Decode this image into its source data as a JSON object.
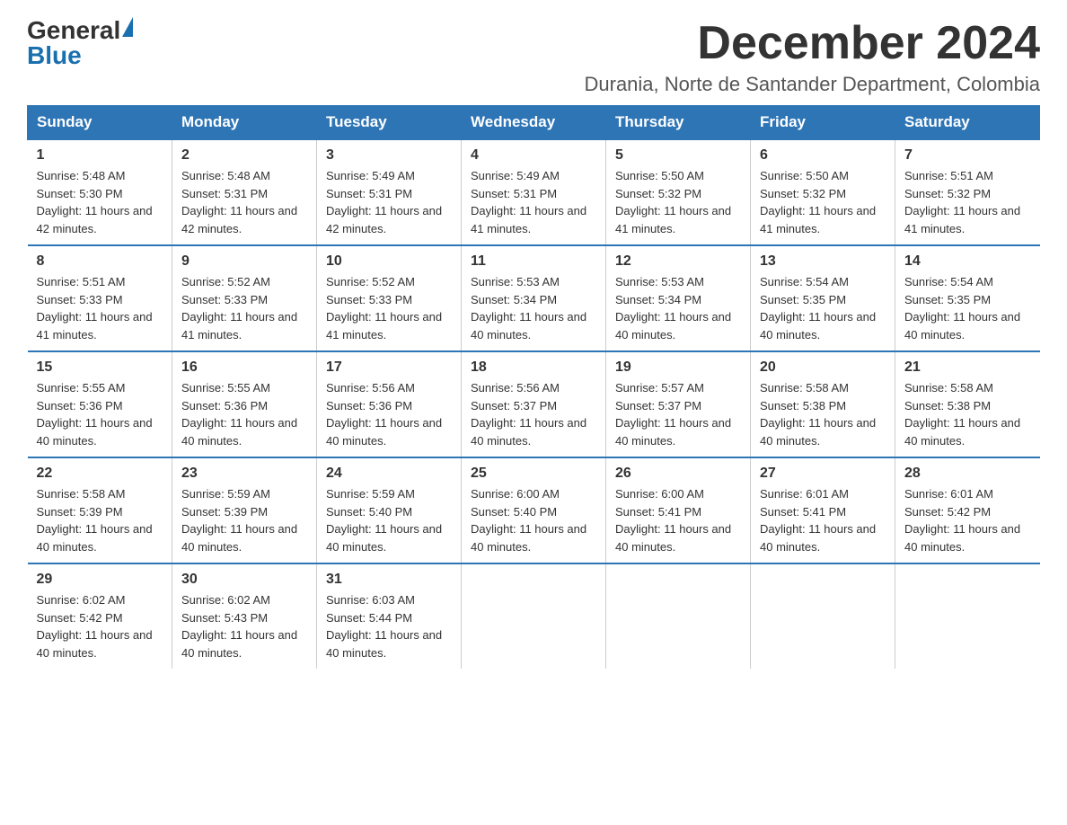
{
  "logo": {
    "text_general": "General",
    "text_blue": "Blue",
    "arrow": "▶"
  },
  "title": "December 2024",
  "subtitle": "Durania, Norte de Santander Department, Colombia",
  "days_header": [
    "Sunday",
    "Monday",
    "Tuesday",
    "Wednesday",
    "Thursday",
    "Friday",
    "Saturday"
  ],
  "weeks": [
    [
      {
        "day": "1",
        "sunrise": "5:48 AM",
        "sunset": "5:30 PM",
        "daylight": "11 hours and 42 minutes."
      },
      {
        "day": "2",
        "sunrise": "5:48 AM",
        "sunset": "5:31 PM",
        "daylight": "11 hours and 42 minutes."
      },
      {
        "day": "3",
        "sunrise": "5:49 AM",
        "sunset": "5:31 PM",
        "daylight": "11 hours and 42 minutes."
      },
      {
        "day": "4",
        "sunrise": "5:49 AM",
        "sunset": "5:31 PM",
        "daylight": "11 hours and 41 minutes."
      },
      {
        "day": "5",
        "sunrise": "5:50 AM",
        "sunset": "5:32 PM",
        "daylight": "11 hours and 41 minutes."
      },
      {
        "day": "6",
        "sunrise": "5:50 AM",
        "sunset": "5:32 PM",
        "daylight": "11 hours and 41 minutes."
      },
      {
        "day": "7",
        "sunrise": "5:51 AM",
        "sunset": "5:32 PM",
        "daylight": "11 hours and 41 minutes."
      }
    ],
    [
      {
        "day": "8",
        "sunrise": "5:51 AM",
        "sunset": "5:33 PM",
        "daylight": "11 hours and 41 minutes."
      },
      {
        "day": "9",
        "sunrise": "5:52 AM",
        "sunset": "5:33 PM",
        "daylight": "11 hours and 41 minutes."
      },
      {
        "day": "10",
        "sunrise": "5:52 AM",
        "sunset": "5:33 PM",
        "daylight": "11 hours and 41 minutes."
      },
      {
        "day": "11",
        "sunrise": "5:53 AM",
        "sunset": "5:34 PM",
        "daylight": "11 hours and 40 minutes."
      },
      {
        "day": "12",
        "sunrise": "5:53 AM",
        "sunset": "5:34 PM",
        "daylight": "11 hours and 40 minutes."
      },
      {
        "day": "13",
        "sunrise": "5:54 AM",
        "sunset": "5:35 PM",
        "daylight": "11 hours and 40 minutes."
      },
      {
        "day": "14",
        "sunrise": "5:54 AM",
        "sunset": "5:35 PM",
        "daylight": "11 hours and 40 minutes."
      }
    ],
    [
      {
        "day": "15",
        "sunrise": "5:55 AM",
        "sunset": "5:36 PM",
        "daylight": "11 hours and 40 minutes."
      },
      {
        "day": "16",
        "sunrise": "5:55 AM",
        "sunset": "5:36 PM",
        "daylight": "11 hours and 40 minutes."
      },
      {
        "day": "17",
        "sunrise": "5:56 AM",
        "sunset": "5:36 PM",
        "daylight": "11 hours and 40 minutes."
      },
      {
        "day": "18",
        "sunrise": "5:56 AM",
        "sunset": "5:37 PM",
        "daylight": "11 hours and 40 minutes."
      },
      {
        "day": "19",
        "sunrise": "5:57 AM",
        "sunset": "5:37 PM",
        "daylight": "11 hours and 40 minutes."
      },
      {
        "day": "20",
        "sunrise": "5:58 AM",
        "sunset": "5:38 PM",
        "daylight": "11 hours and 40 minutes."
      },
      {
        "day": "21",
        "sunrise": "5:58 AM",
        "sunset": "5:38 PM",
        "daylight": "11 hours and 40 minutes."
      }
    ],
    [
      {
        "day": "22",
        "sunrise": "5:58 AM",
        "sunset": "5:39 PM",
        "daylight": "11 hours and 40 minutes."
      },
      {
        "day": "23",
        "sunrise": "5:59 AM",
        "sunset": "5:39 PM",
        "daylight": "11 hours and 40 minutes."
      },
      {
        "day": "24",
        "sunrise": "5:59 AM",
        "sunset": "5:40 PM",
        "daylight": "11 hours and 40 minutes."
      },
      {
        "day": "25",
        "sunrise": "6:00 AM",
        "sunset": "5:40 PM",
        "daylight": "11 hours and 40 minutes."
      },
      {
        "day": "26",
        "sunrise": "6:00 AM",
        "sunset": "5:41 PM",
        "daylight": "11 hours and 40 minutes."
      },
      {
        "day": "27",
        "sunrise": "6:01 AM",
        "sunset": "5:41 PM",
        "daylight": "11 hours and 40 minutes."
      },
      {
        "day": "28",
        "sunrise": "6:01 AM",
        "sunset": "5:42 PM",
        "daylight": "11 hours and 40 minutes."
      }
    ],
    [
      {
        "day": "29",
        "sunrise": "6:02 AM",
        "sunset": "5:42 PM",
        "daylight": "11 hours and 40 minutes."
      },
      {
        "day": "30",
        "sunrise": "6:02 AM",
        "sunset": "5:43 PM",
        "daylight": "11 hours and 40 minutes."
      },
      {
        "day": "31",
        "sunrise": "6:03 AM",
        "sunset": "5:44 PM",
        "daylight": "11 hours and 40 minutes."
      },
      null,
      null,
      null,
      null
    ]
  ],
  "labels": {
    "sunrise": "Sunrise:",
    "sunset": "Sunset:",
    "daylight": "Daylight:"
  }
}
